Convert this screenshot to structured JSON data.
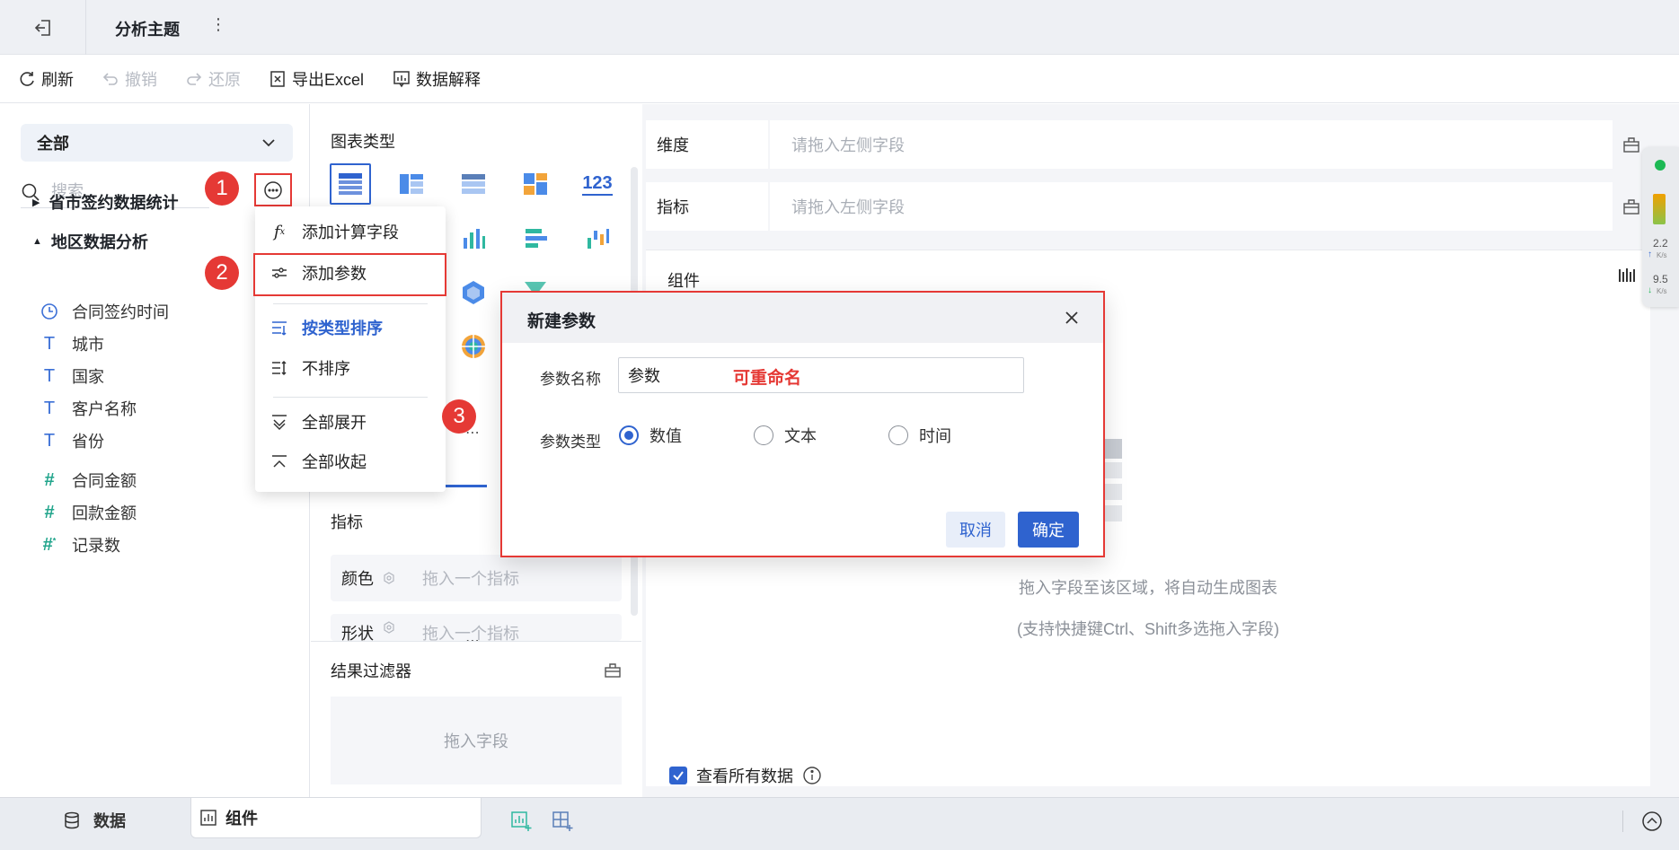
{
  "topbar": {
    "title": "分析主题",
    "more": "⋮"
  },
  "toolbar": {
    "refresh": "刷新",
    "undo": "撤销",
    "redo": "还原",
    "export_excel": "导出Excel",
    "data_explain": "数据解释"
  },
  "left": {
    "dataset": "全部",
    "search_placeholder": "搜索",
    "groups": [
      {
        "label": "省市签约数据统计",
        "expanded": false
      },
      {
        "label": "地区数据分析",
        "expanded": true
      }
    ],
    "fields": [
      {
        "icon": "clock-icon",
        "label": "合同签约时间"
      },
      {
        "icon": "text-type-icon",
        "label": "城市"
      },
      {
        "icon": "text-type-icon",
        "label": "国家"
      },
      {
        "icon": "text-type-icon",
        "label": "客户名称"
      },
      {
        "icon": "text-type-icon",
        "label": "省份"
      },
      {
        "icon": "number-type-icon",
        "label": "合同金额"
      },
      {
        "icon": "number-type-icon",
        "label": "回款金额"
      },
      {
        "icon": "record-count-icon",
        "label": "记录数"
      }
    ]
  },
  "steps": [
    "1",
    "2",
    "3"
  ],
  "menu": {
    "add_calc_field": "添加计算字段",
    "add_param": "添加参数",
    "sort_by_type": "按类型排序",
    "no_sort": "不排序",
    "expand_all": "全部展开",
    "collapse_all": "全部收起"
  },
  "middle": {
    "chart_type_label": "图表类型",
    "metric_label": "指标",
    "color_label": "颜色",
    "color_placeholder": "拖入一个指标",
    "shape_label": "形状",
    "shape_placeholder": "拖入一个指标",
    "result_filter": "结果过滤器",
    "filter_placeholder": "拖入字段",
    "number_chart_text": "123"
  },
  "right": {
    "dimension_label": "维度",
    "dimension_placeholder": "请拖入左侧字段",
    "metric_label": "指标",
    "metric_placeholder": "请拖入左侧字段",
    "component_title": "组件",
    "hint_line1": "拖入字段至该区域，将自动生成图表",
    "hint_line2": "(支持快捷键Ctrl、Shift多选拖入字段)",
    "view_all_data": "查看所有数据",
    "view_all_checked": true
  },
  "net_widget": {
    "up_value": "2.2",
    "up_unit": "K/s",
    "down_value": "9.5",
    "down_unit": "K/s"
  },
  "bottom": {
    "data_tab": "数据",
    "component_tab": "组件"
  },
  "dialog": {
    "title": "新建参数",
    "name_label": "参数名称",
    "name_value": "参数",
    "rename_note": "可重命名",
    "type_label": "参数类型",
    "types": [
      "数值",
      "文本",
      "时间"
    ],
    "selected_type": "数值",
    "cancel": "取消",
    "confirm": "确定"
  },
  "colors": {
    "accent": "#2f63cf",
    "highlight_red": "#e53935",
    "numeric_field": "#22a58c"
  }
}
